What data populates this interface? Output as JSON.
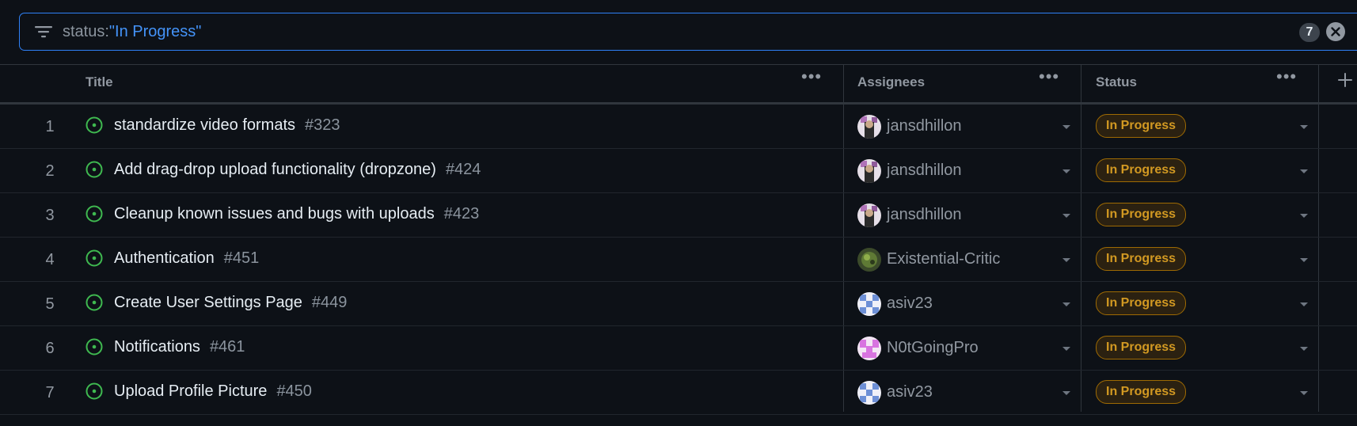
{
  "filter": {
    "key": "status:",
    "value": "\"In Progress\"",
    "count": "7"
  },
  "columns": {
    "title": "Title",
    "assignees": "Assignees",
    "status": "Status",
    "more": "•••"
  },
  "rows": [
    {
      "num": "1",
      "title": "standardize video formats",
      "issue": "#323",
      "assignee": "jansdhillon",
      "status": "In Progress"
    },
    {
      "num": "2",
      "title": "Add drag-drop upload functionality (dropzone)",
      "issue": "#424",
      "assignee": "jansdhillon",
      "status": "In Progress"
    },
    {
      "num": "3",
      "title": "Cleanup known issues and bugs with uploads",
      "issue": "#423",
      "assignee": "jansdhillon",
      "status": "In Progress"
    },
    {
      "num": "4",
      "title": "Authentication",
      "issue": "#451",
      "assignee": "Existential-Critic",
      "status": "In Progress"
    },
    {
      "num": "5",
      "title": "Create User Settings Page",
      "issue": "#449",
      "assignee": "asiv23",
      "status": "In Progress"
    },
    {
      "num": "6",
      "title": "Notifications",
      "issue": "#461",
      "assignee": "N0tGoingPro",
      "status": "In Progress"
    },
    {
      "num": "7",
      "title": "Upload Profile Picture",
      "issue": "#450",
      "assignee": "asiv23",
      "status": "In Progress"
    }
  ],
  "icons": {
    "filter": "filter-icon",
    "clear": "x-circle-icon",
    "issue": "issue-open-icon",
    "add_column": "plus-icon",
    "dropdown": "caret-down-icon"
  },
  "colors": {
    "accent": "#2f81f7",
    "issue_open": "#3fb950",
    "status_fg": "#d29922",
    "status_border": "#9e6a03"
  }
}
